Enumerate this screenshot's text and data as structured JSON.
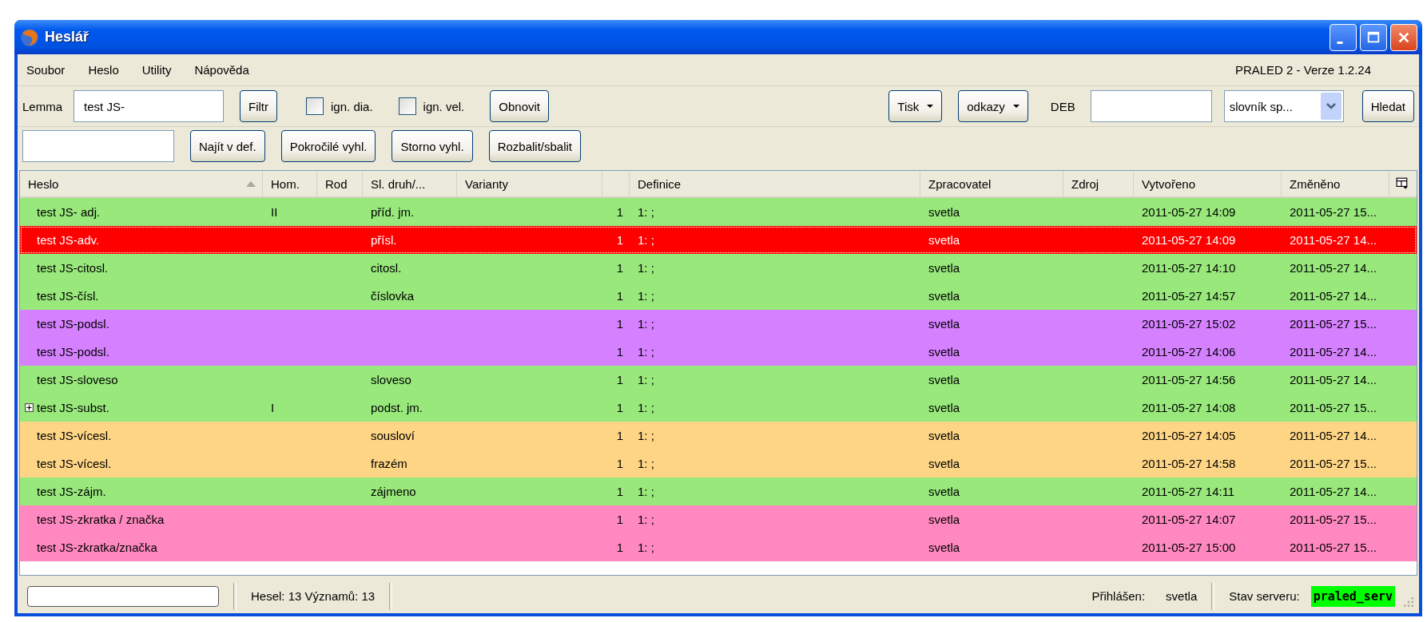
{
  "window": {
    "title": "Heslář"
  },
  "menu": [
    "Soubor",
    "Heslo",
    "Utility",
    "Nápověda"
  ],
  "version": "PRALED 2 - Verze 1.2.24",
  "toolbar": {
    "lemma_label": "Lemma",
    "lemma_value": "test JS-",
    "filter_button": "Filtr",
    "checkboxes": [
      {
        "label": "ign. dia.",
        "checked": false
      },
      {
        "label": "ign. vel.",
        "checked": false
      }
    ],
    "refresh_button": "Obnovit",
    "print_button": "Tisk",
    "links_button": "odkazy",
    "deb_label": "DEB",
    "dictionary_select": "slovník sp...",
    "search_button": "Hledat"
  },
  "toolbar2": {
    "buttons": [
      "Najít v def.",
      "Pokročilé vyhl.",
      "Storno vyhl.",
      "Rozbalit/sbalit"
    ]
  },
  "table": {
    "columns": [
      {
        "label": "Heslo",
        "sorted": true
      },
      {
        "label": "Hom.",
        "sorted": false
      },
      {
        "label": "Rod",
        "sorted": false
      },
      {
        "label": "Sl. druh/...",
        "sorted": false
      },
      {
        "label": "Varianty",
        "sorted": false
      },
      {
        "sorted": false
      },
      {
        "label": "Definice",
        "sorted": false
      },
      {
        "label": "Zpracovatel",
        "sorted": false
      },
      {
        "label": "Zdroj",
        "sorted": false
      },
      {
        "label": "Vytvořeno",
        "sorted": false
      },
      {
        "label": "Změněno",
        "sorted": false
      }
    ],
    "rows": [
      {
        "cells": [
          "test JS- adj.",
          "II",
          "",
          "příd. jm.",
          "",
          "1",
          "1: ;",
          "svetla",
          "",
          "2011-05-27 14:09",
          "2011-05-27 15..."
        ],
        "color": "#98e87c",
        "selected": false,
        "expandable": false
      },
      {
        "cells": [
          "test JS-adv.",
          "",
          "",
          "přísl.",
          "",
          "1",
          "1: ;",
          "svetla",
          "",
          "2011-05-27 14:09",
          "2011-05-27 14..."
        ],
        "color": "#ff0000",
        "selected": true,
        "expandable": false
      },
      {
        "cells": [
          "test JS-citosl.",
          "",
          "",
          "citosl.",
          "",
          "1",
          "1: ;",
          "svetla",
          "",
          "2011-05-27 14:10",
          "2011-05-27 14..."
        ],
        "color": "#98e87c",
        "selected": false,
        "expandable": false
      },
      {
        "cells": [
          "test JS-čísl.",
          "",
          "",
          "číslovka",
          "",
          "1",
          "1: ;",
          "svetla",
          "",
          "2011-05-27 14:57",
          "2011-05-27 14..."
        ],
        "color": "#98e87c",
        "selected": false,
        "expandable": false
      },
      {
        "cells": [
          "test JS-podsl.",
          "",
          "",
          "",
          "",
          "1",
          "1: ;",
          "svetla",
          "",
          "2011-05-27 15:02",
          "2011-05-27 15..."
        ],
        "color": "#d580ff",
        "selected": false,
        "expandable": false
      },
      {
        "cells": [
          "test JS-podsl.",
          "",
          "",
          "",
          "",
          "1",
          "1: ;",
          "svetla",
          "",
          "2011-05-27 14:06",
          "2011-05-27 14..."
        ],
        "color": "#d580ff",
        "selected": false,
        "expandable": false
      },
      {
        "cells": [
          "test JS-sloveso",
          "",
          "",
          "sloveso",
          "",
          "1",
          "1: ;",
          "svetla",
          "",
          "2011-05-27 14:56",
          "2011-05-27 14..."
        ],
        "color": "#98e87c",
        "selected": false,
        "expandable": false
      },
      {
        "cells": [
          "test JS-subst.",
          "I",
          "",
          "podst. jm.",
          "",
          "1",
          "1: ;",
          "svetla",
          "",
          "2011-05-27 14:08",
          "2011-05-27 15..."
        ],
        "color": "#98e87c",
        "selected": false,
        "expandable": true
      },
      {
        "cells": [
          "test JS-vícesl.",
          "",
          "",
          "sousloví",
          "",
          "1",
          "1: ;",
          "svetla",
          "",
          "2011-05-27 14:05",
          "2011-05-27 14..."
        ],
        "color": "#fdd585",
        "selected": false,
        "expandable": false
      },
      {
        "cells": [
          "test JS-vícesl.",
          "",
          "",
          "frazém",
          "",
          "1",
          "1: ;",
          "svetla",
          "",
          "2011-05-27 14:58",
          "2011-05-27 15..."
        ],
        "color": "#fdd585",
        "selected": false,
        "expandable": false
      },
      {
        "cells": [
          "test JS-zájm.",
          "",
          "",
          "zájmeno",
          "",
          "1",
          "1: ;",
          "svetla",
          "",
          "2011-05-27 14:11",
          "2011-05-27 14..."
        ],
        "color": "#98e87c",
        "selected": false,
        "expandable": false
      },
      {
        "cells": [
          "test JS-zkratka / značka",
          "",
          "",
          "",
          "",
          "1",
          "1: ;",
          "svetla",
          "",
          "2011-05-27 14:07",
          "2011-05-27 15..."
        ],
        "color": "#ff88c0",
        "selected": false,
        "expandable": false
      },
      {
        "cells": [
          "test JS-zkratka/značka",
          "",
          "",
          "",
          "",
          "1",
          "1: ;",
          "svetla",
          "",
          "2011-05-27 15:00",
          "2011-05-27 15..."
        ],
        "color": "#ff88c0",
        "selected": false,
        "expandable": false
      }
    ]
  },
  "status_bar": {
    "counts": "Hesel: 13 Významů: 13",
    "user_label": "Přihlášen:",
    "user": "svetla",
    "server_label": "Stav serveru:",
    "server": "praled_serv"
  }
}
